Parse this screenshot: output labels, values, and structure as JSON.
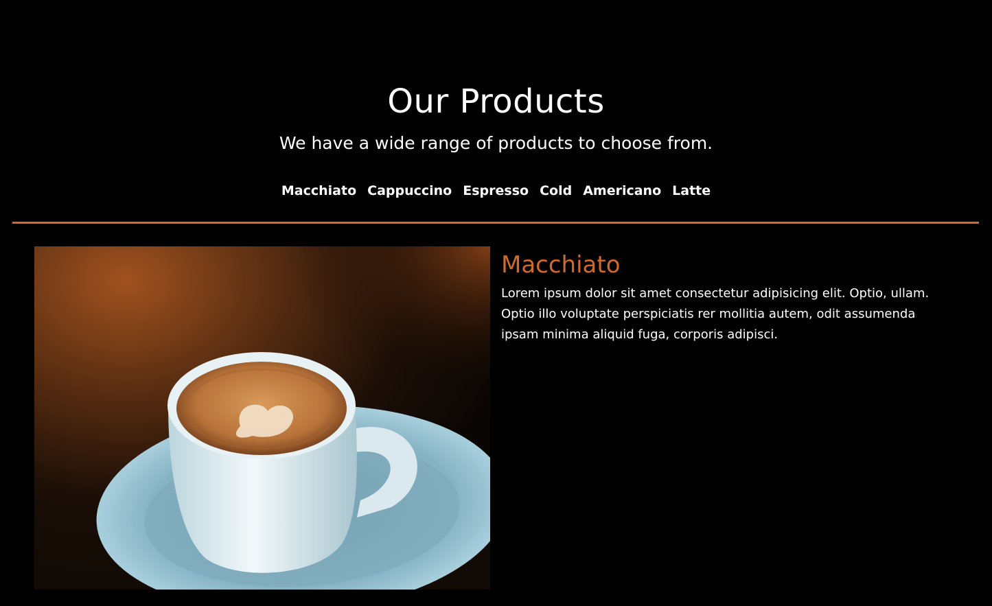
{
  "section": {
    "title": "Our Products",
    "subtitle": "We have a wide range of products to choose from."
  },
  "tabs": [
    "Macchiato",
    "Cappuccino",
    "Espresso",
    "Cold",
    "Americano",
    "Latte"
  ],
  "product": {
    "name": "Macchiato",
    "description": "Lorem ipsum dolor sit amet consectetur adipisicing elit. Optio, ullam. Optio illo voluptate perspiciatis rer mollitia autem, odit assumenda ipsam minima aliquid fuga, corporis adipisci.",
    "image_icon": "coffee-cup-photo"
  },
  "colors": {
    "accent": "#d2692a",
    "background": "#000000",
    "text": "#ffffff"
  }
}
